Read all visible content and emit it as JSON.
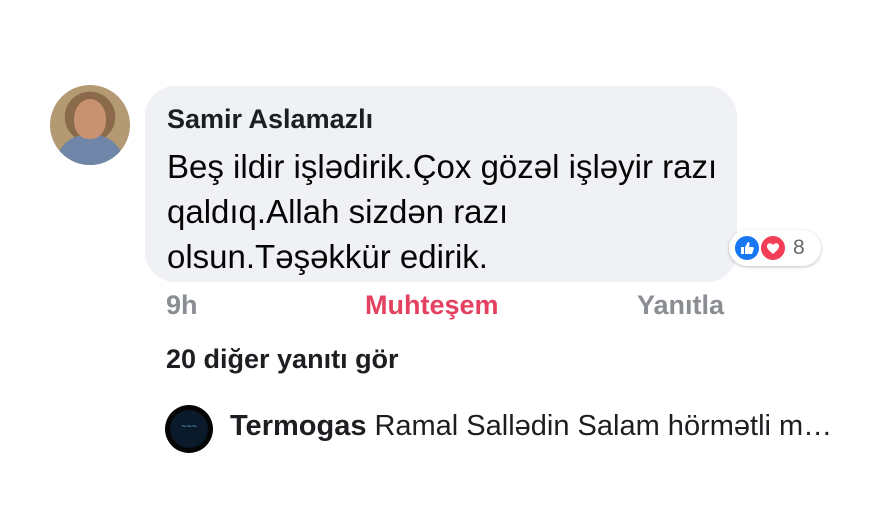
{
  "comment": {
    "author": "Samir Aslamazlı",
    "text": "Beş ildir işlədirik.Çox gözəl işləyir razı qaldıq.Allah sizdən razı olsun.Təşəkkür edirik.",
    "reactions": {
      "types": [
        "like-icon",
        "love-icon"
      ],
      "count": "8"
    },
    "time": "9h",
    "reaction_label": "Muhteşem",
    "reply_label": "Yanıtla"
  },
  "more_replies_label": "20 diğer yanıtı gör",
  "latest_reply": {
    "author": "Termogas",
    "preview": "Ramal Sallədin Salam hörmətli m…"
  },
  "colors": {
    "reaction_text": "#e4405f",
    "bubble": "#eff1f4",
    "like": "#1877f2",
    "love": "#f33e58"
  }
}
